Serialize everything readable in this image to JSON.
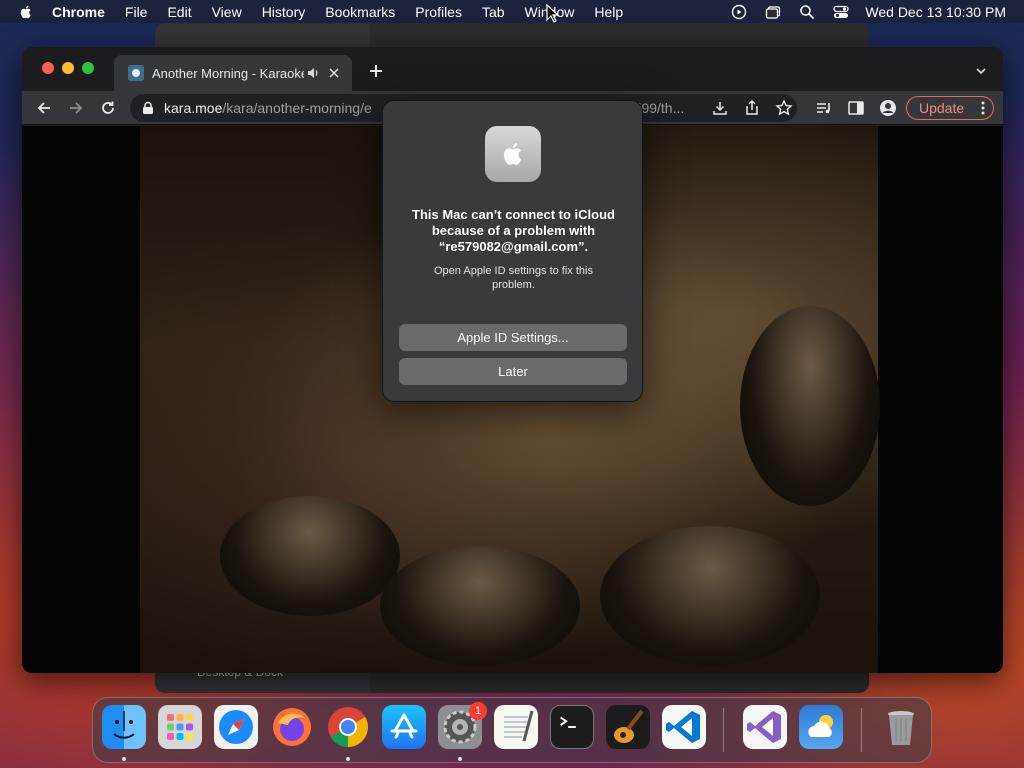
{
  "menubar": {
    "app_name": "Chrome",
    "items": [
      "File",
      "Edit",
      "View",
      "History",
      "Bookmarks",
      "Profiles",
      "Tab",
      "Window",
      "Help"
    ],
    "clock": "Wed Dec 13  10:30 PM"
  },
  "background_window": {
    "sidebar_label": "Desktop & Dock"
  },
  "browser": {
    "tab_title": "Another Morning - Karaoke",
    "url_host": "kara.moe",
    "url_path": "/kara/another-morning/e",
    "url_tail": "fd99/th...",
    "update_label": "Update"
  },
  "dialog": {
    "heading": "This Mac can’t connect to iCloud because of a problem with “re579082@gmail.com”.",
    "body": "Open Apple ID settings to fix this problem.",
    "primary_button": "Apple ID Settings...",
    "secondary_button": "Later"
  },
  "dock": {
    "apps": [
      "Finder",
      "Launchpad",
      "Safari",
      "Firefox",
      "Google Chrome",
      "App Store",
      "System Settings",
      "TextEdit",
      "Terminal",
      "GarageBand",
      "Visual Studio Code",
      "Visual Studio",
      "Weather",
      "Trash"
    ],
    "system_settings_badge": "1"
  },
  "colors": {
    "accent_update": "#f28b82",
    "dialog_bg": "#3a3a3c",
    "badge": "#ff3b30"
  }
}
